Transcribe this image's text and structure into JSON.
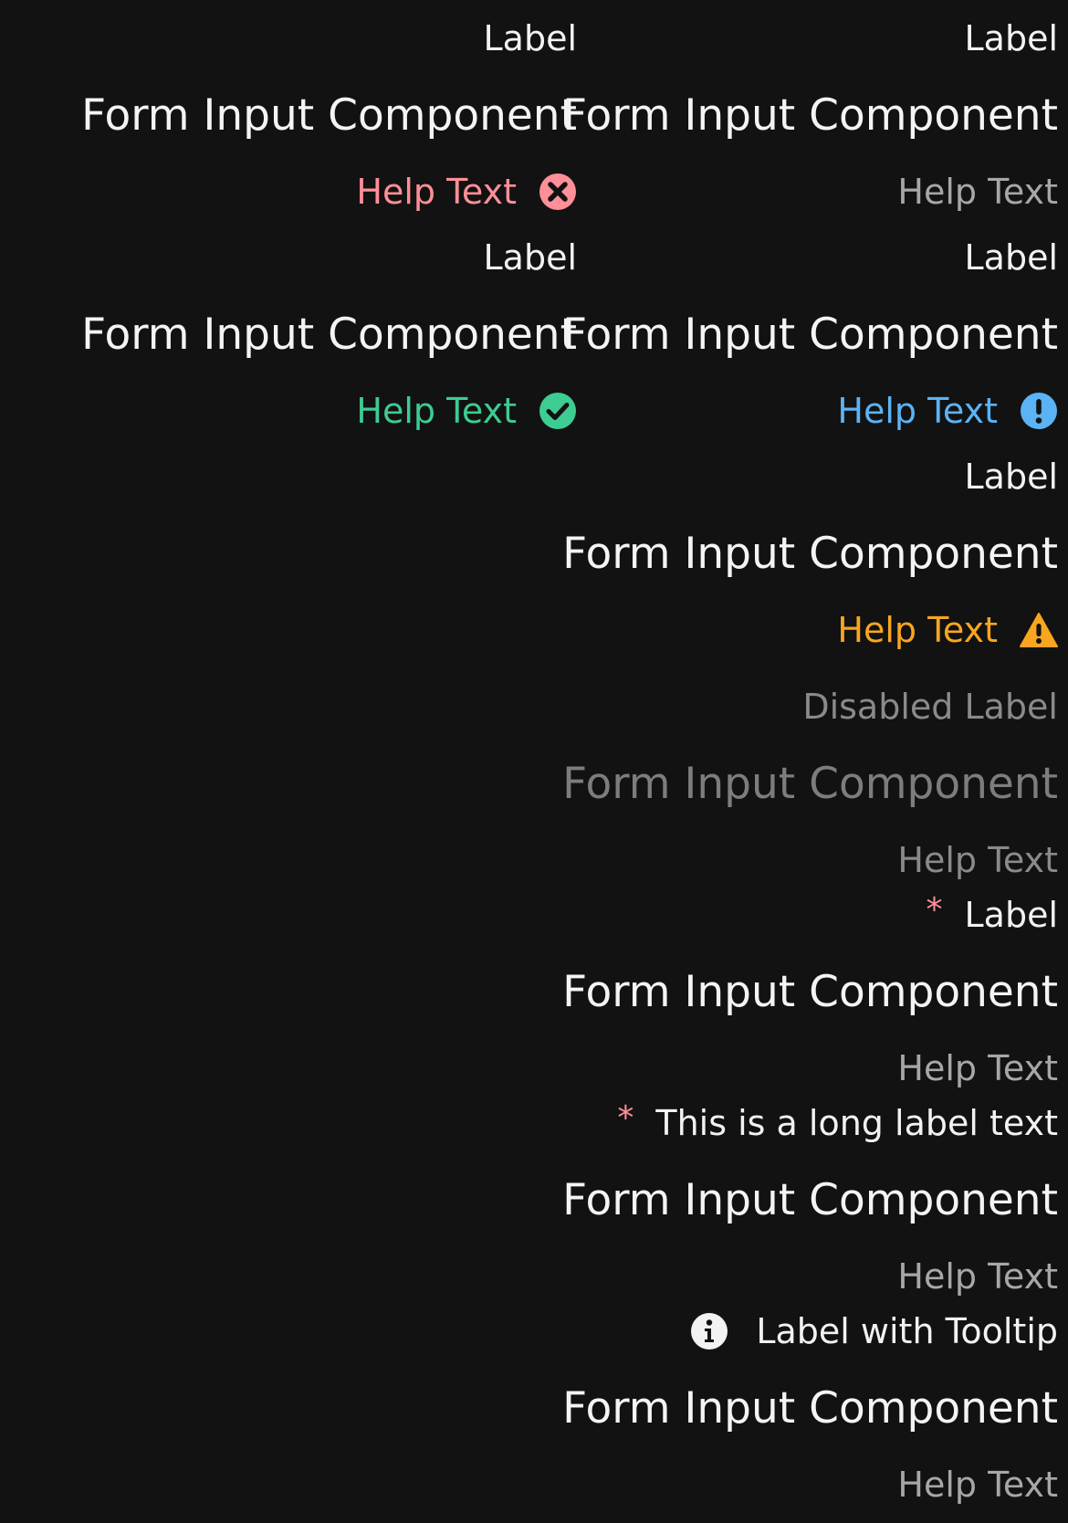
{
  "colors": {
    "background": "#121212",
    "error": "#ff8f99",
    "success": "#3dcc91",
    "info": "#5bb3f5",
    "warning": "#f8a620",
    "required": "#ff8f99"
  },
  "fields": {
    "error": {
      "label": "Label",
      "input": "Form Input Component",
      "help": "Help Text",
      "icon": "error-circle-icon"
    },
    "default": {
      "label": "Label",
      "input": "Form Input Component",
      "help": "Help Text"
    },
    "success": {
      "label": "Label",
      "input": "Form Input Component",
      "help": "Help Text",
      "icon": "check-circle-icon"
    },
    "info": {
      "label": "Label",
      "input": "Form Input Component",
      "help": "Help Text",
      "icon": "exclamation-circle-icon"
    },
    "warning": {
      "label": "Label",
      "input": "Form Input Component",
      "help": "Help Text",
      "icon": "warning-triangle-icon"
    },
    "disabled": {
      "label": "Disabled Label",
      "input": "Form Input Component",
      "help": "Help Text"
    },
    "required": {
      "required_mark": "*",
      "label": "Label",
      "input": "Form Input Component",
      "help": "Help Text"
    },
    "required_long": {
      "required_mark": "*",
      "label": "This is a long label text",
      "input": "Form Input Component",
      "help": "Help Text"
    },
    "tooltip": {
      "label": "Label with Tooltip",
      "input": "Form Input Component",
      "help": "Help Text",
      "icon": "info-circle-icon"
    }
  }
}
